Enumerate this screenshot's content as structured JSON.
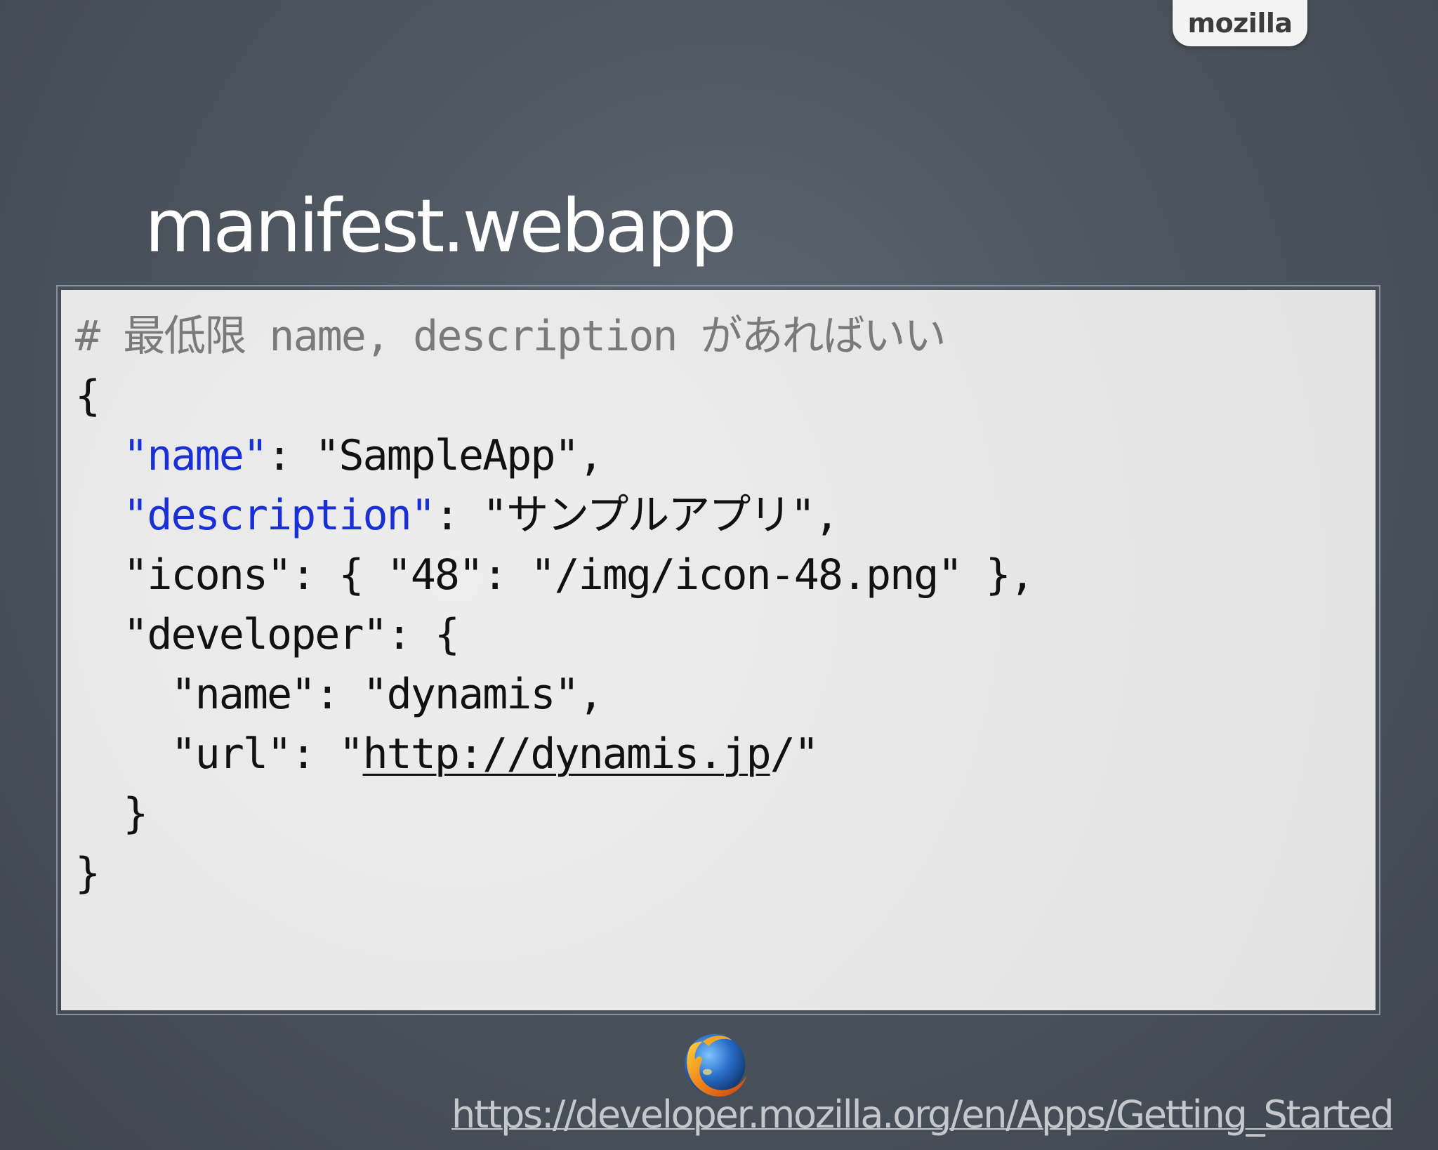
{
  "brand": {
    "tab_label": "mozilla"
  },
  "slide": {
    "title": "manifest.webapp"
  },
  "code": {
    "lines": [
      {
        "parts": [
          {
            "text": "# 最低限 name, description があればいい",
            "style": "comment"
          }
        ]
      },
      {
        "parts": [
          {
            "text": "{",
            "style": "plain"
          }
        ]
      },
      {
        "parts": [
          {
            "text": "  ",
            "style": "plain"
          },
          {
            "text": "\"name\"",
            "style": "key-blue"
          },
          {
            "text": ": \"SampleApp\",",
            "style": "plain"
          }
        ]
      },
      {
        "parts": [
          {
            "text": "  ",
            "style": "plain"
          },
          {
            "text": "\"description\"",
            "style": "key-blue"
          },
          {
            "text": ": \"サンプルアプリ\",",
            "style": "plain"
          }
        ]
      },
      {
        "parts": [
          {
            "text": "  \"icons\": { \"48\": \"/img/icon-48.png\" },",
            "style": "plain"
          }
        ]
      },
      {
        "parts": [
          {
            "text": "  \"developer\": {",
            "style": "plain"
          }
        ]
      },
      {
        "parts": [
          {
            "text": "    \"name\": \"dynamis\",",
            "style": "plain"
          }
        ]
      },
      {
        "parts": [
          {
            "text": "    \"url\": \"",
            "style": "plain"
          },
          {
            "text": "http://dynamis.jp",
            "style": "link"
          },
          {
            "text": "/\"",
            "style": "plain"
          }
        ]
      },
      {
        "parts": [
          {
            "text": "  }",
            "style": "plain"
          }
        ]
      },
      {
        "parts": [
          {
            "text": "}",
            "style": "plain"
          }
        ]
      }
    ]
  },
  "footer": {
    "url": "https://developer.mozilla.org/en/Apps/Getting_Started",
    "logo_icon": "firefox-logo-icon"
  },
  "colors": {
    "background": "#4a525c",
    "code_background": "#e9e9e9",
    "key_blue": "#1a2fd6",
    "comment_gray": "#7a7a7a",
    "title_white": "#ffffff"
  }
}
